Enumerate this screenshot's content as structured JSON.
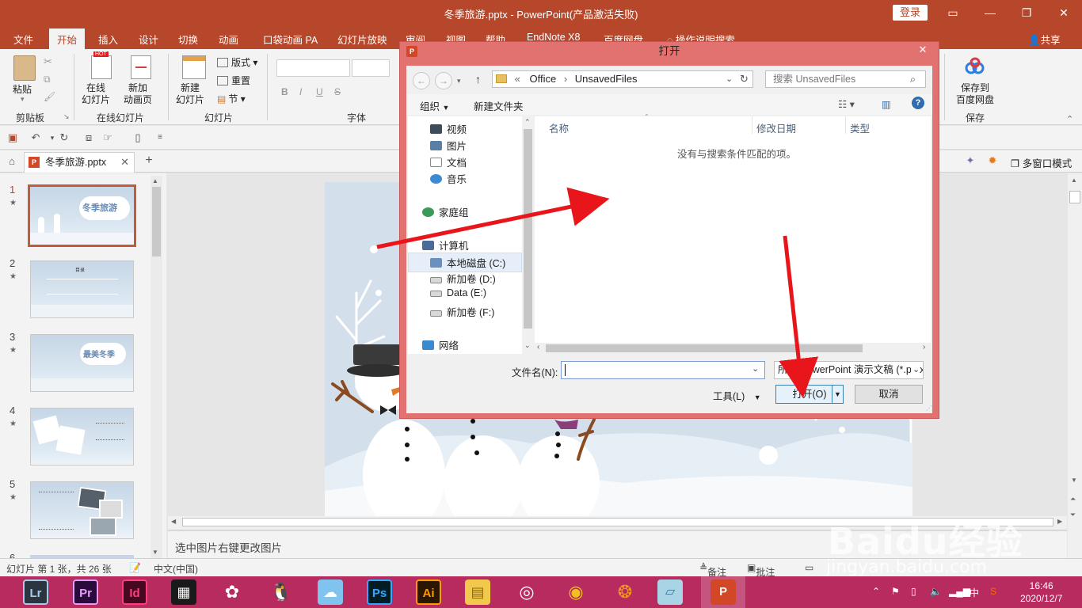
{
  "window": {
    "title": "冬季旅游.pptx  -  PowerPoint(产品激活失败)",
    "login": "登录"
  },
  "menu": {
    "items": [
      "文件",
      "开始",
      "插入",
      "设计",
      "切换",
      "动画",
      "口袋动画 PA",
      "幻灯片放映",
      "审阅",
      "视图",
      "帮助",
      "EndNote X8",
      "百度网盘",
      "操作说明搜索"
    ],
    "active": "开始",
    "share": "共享"
  },
  "ribbon": {
    "paste": "粘贴",
    "clipboard": "剪贴板",
    "online_slide": "在线\n幻灯片",
    "new_anim": "新加\n动画页",
    "online_group": "在线幻灯片",
    "new_slide": "新建\n幻灯片",
    "layout": "版式",
    "reset": "重置",
    "section": "节",
    "slides_group": "幻灯片",
    "font_group": "字体",
    "save_baidu": "保存到\n百度网盘",
    "save_group": "保存",
    "font_btns": [
      "B",
      "I",
      "U",
      "S"
    ]
  },
  "doc_tab": {
    "name": "冬季旅游.pptx",
    "multiwin": "多窗口模式"
  },
  "thumbnails": [
    {
      "num": "1",
      "text": "冬季旅游"
    },
    {
      "num": "2",
      "text": "目录"
    },
    {
      "num": "3",
      "text": "最美冬季"
    },
    {
      "num": "4",
      "text": ""
    },
    {
      "num": "5",
      "text": ""
    },
    {
      "num": "6",
      "text": ""
    }
  ],
  "notes_text": "选中图片右键更改图片",
  "status": {
    "slide_info": "幻灯片 第 1 张，共 26 张",
    "language": "中文(中国)",
    "notes": "备注",
    "comments": "批注"
  },
  "taskbar": {
    "apps": [
      "Lr",
      "Pr",
      "Id",
      "Ps",
      "Ai"
    ],
    "time": "16:46",
    "date": "2020/12/7",
    "ime": "中"
  },
  "dialog": {
    "title": "打开",
    "path": [
      "Office",
      "UnsavedFiles"
    ],
    "path_prefix": "«",
    "search_placeholder": "搜索 UnsavedFiles",
    "organize": "组织",
    "new_folder": "新建文件夹",
    "tree": [
      "视频",
      "图片",
      "文档",
      "音乐",
      "家庭组",
      "计算机",
      "本地磁盘 (C:)",
      "新加卷 (D:)",
      "Data (E:)",
      "新加卷 (F:)",
      "网络"
    ],
    "columns": [
      "名称",
      "修改日期",
      "类型"
    ],
    "empty": "没有与搜索条件匹配的项。",
    "filename_label": "文件名(N):",
    "filetype": "所有 PowerPoint 演示文稿 (*.pptx)",
    "tools": "工具(L)",
    "open": "打开(O)",
    "cancel": "取消"
  },
  "watermark": {
    "main": "Baidu经验",
    "sub": "jingyan.baidu.com"
  },
  "colors": {
    "brand": "#b7472a",
    "dialog_frame": "#e27270",
    "taskbar": "#b72b5f",
    "arrow": "#e8161b"
  }
}
